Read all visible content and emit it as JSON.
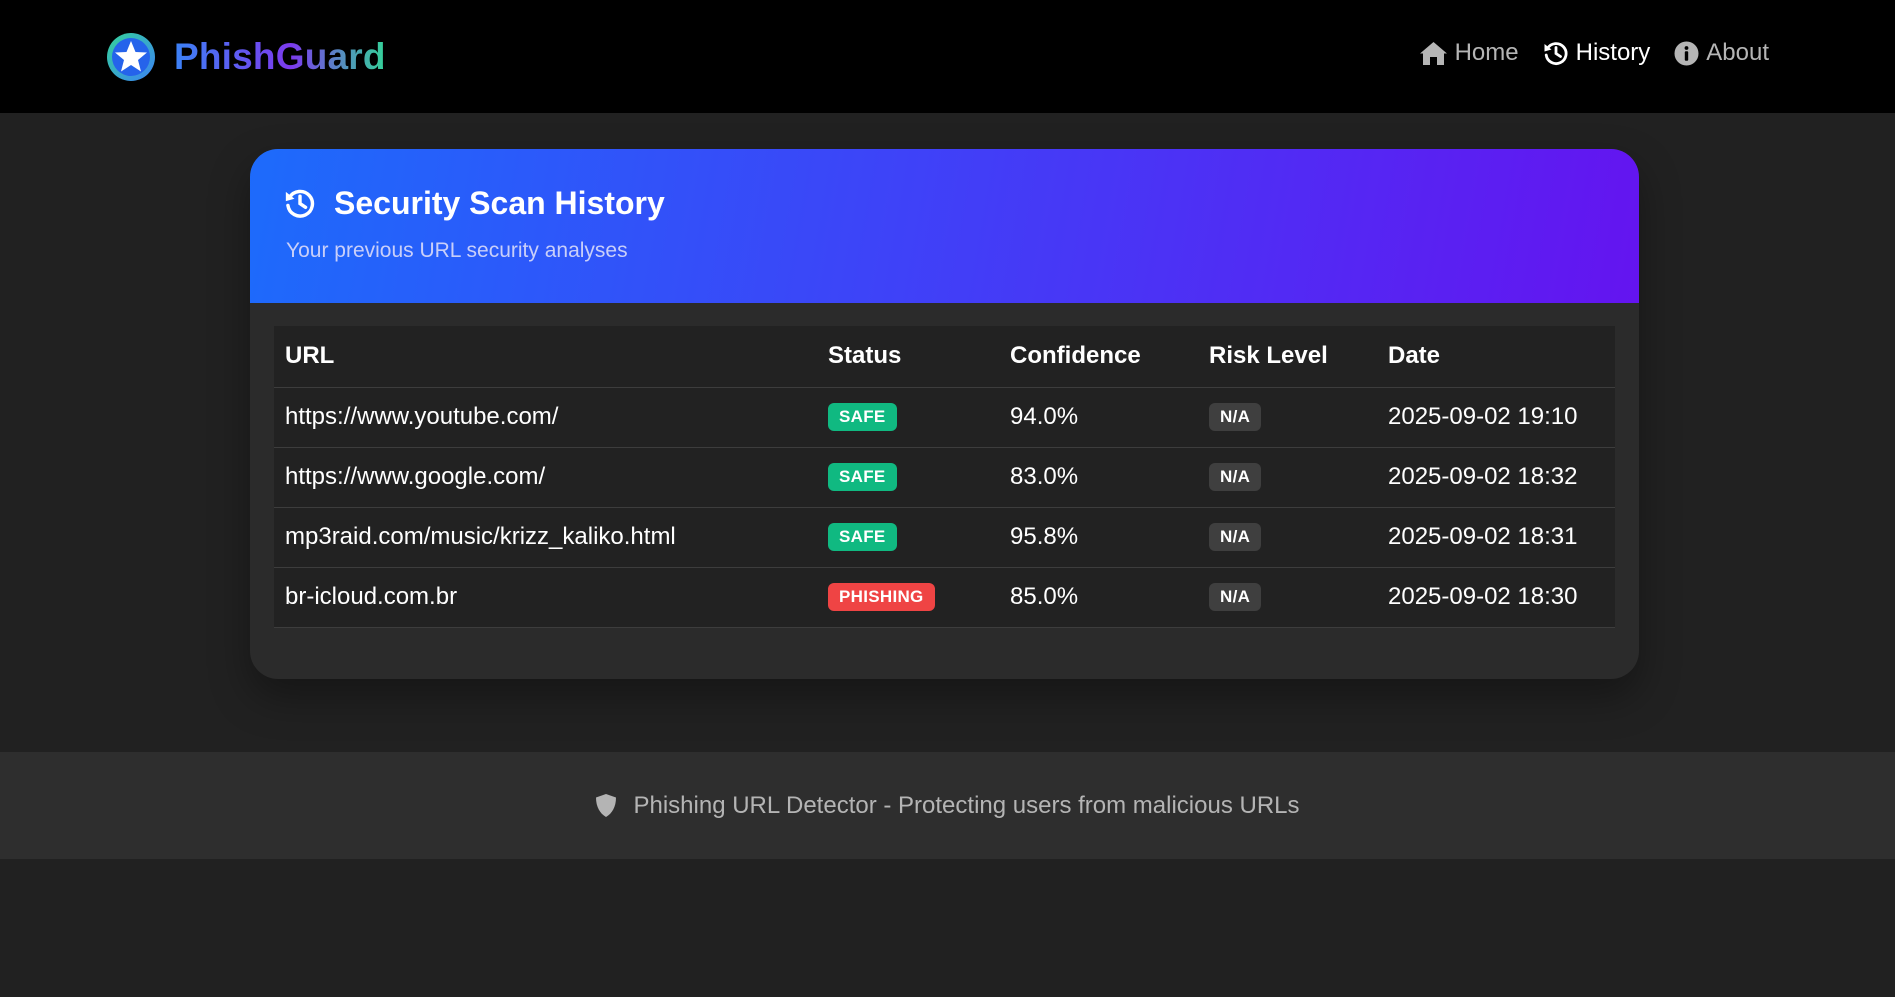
{
  "brand": {
    "name": "PhishGuard",
    "logo_icon": "star-badge-icon"
  },
  "nav": {
    "items": [
      {
        "label": "Home",
        "icon": "home-icon",
        "active": false
      },
      {
        "label": "History",
        "icon": "history-icon",
        "active": true
      },
      {
        "label": "About",
        "icon": "info-icon",
        "active": false
      }
    ]
  },
  "history": {
    "title": "Security Scan History",
    "subtitle": "Your previous URL security analyses",
    "title_icon": "history-icon",
    "columns": [
      "URL",
      "Status",
      "Confidence",
      "Risk Level",
      "Date"
    ],
    "rows": [
      {
        "url": "https://www.youtube.com/",
        "status": "SAFE",
        "confidence": "94.0%",
        "risk": "N/A",
        "date": "2025-09-02 19:10"
      },
      {
        "url": "https://www.google.com/",
        "status": "SAFE",
        "confidence": "83.0%",
        "risk": "N/A",
        "date": "2025-09-02 18:32"
      },
      {
        "url": "mp3raid.com/music/krizz_kaliko.html",
        "status": "SAFE",
        "confidence": "95.8%",
        "risk": "N/A",
        "date": "2025-09-02 18:31"
      },
      {
        "url": "br-icloud.com.br",
        "status": "PHISHING",
        "confidence": "85.0%",
        "risk": "N/A",
        "date": "2025-09-02 18:30"
      }
    ]
  },
  "footer": {
    "text": "Phishing URL Detector - Protecting users from malicious URLs",
    "icon": "shield-icon"
  },
  "colors": {
    "safe": "#10b981",
    "phishing": "#ef4444",
    "header_gradient_start": "#1d6bfb",
    "header_gradient_end": "#6414f0"
  }
}
